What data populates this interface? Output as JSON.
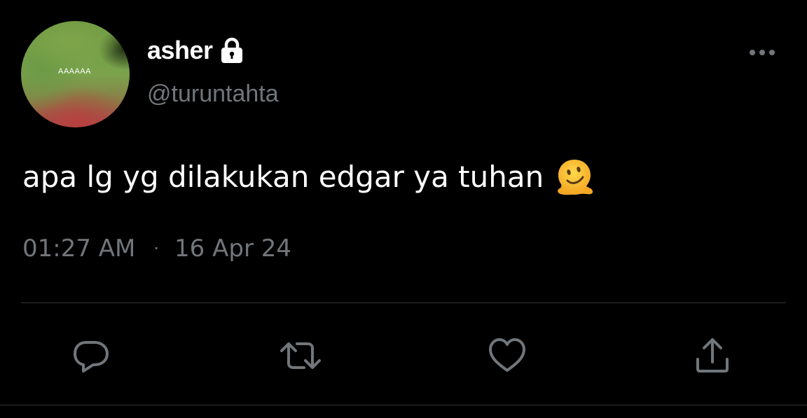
{
  "tweet": {
    "author": {
      "display_name": "asher",
      "handle": "@turuntahta",
      "avatar_text": "AAAAAA",
      "protected": true,
      "lock_icon": "lock-icon"
    },
    "text": "apa lg yg dilakukan edgar ya tuhan",
    "emoji": "melting-face",
    "time": "01:27 AM",
    "separator": "·",
    "date": "16 Apr 24"
  },
  "actions": [
    {
      "name": "reply",
      "icon": "reply-icon"
    },
    {
      "name": "retweet",
      "icon": "retweet-icon"
    },
    {
      "name": "like",
      "icon": "heart-icon"
    },
    {
      "name": "share",
      "icon": "share-icon"
    }
  ],
  "colors": {
    "background": "#000000",
    "primary_text": "#ffffff",
    "secondary_text": "#71767b",
    "divider": "#2f3336",
    "icon": "#71767b"
  }
}
